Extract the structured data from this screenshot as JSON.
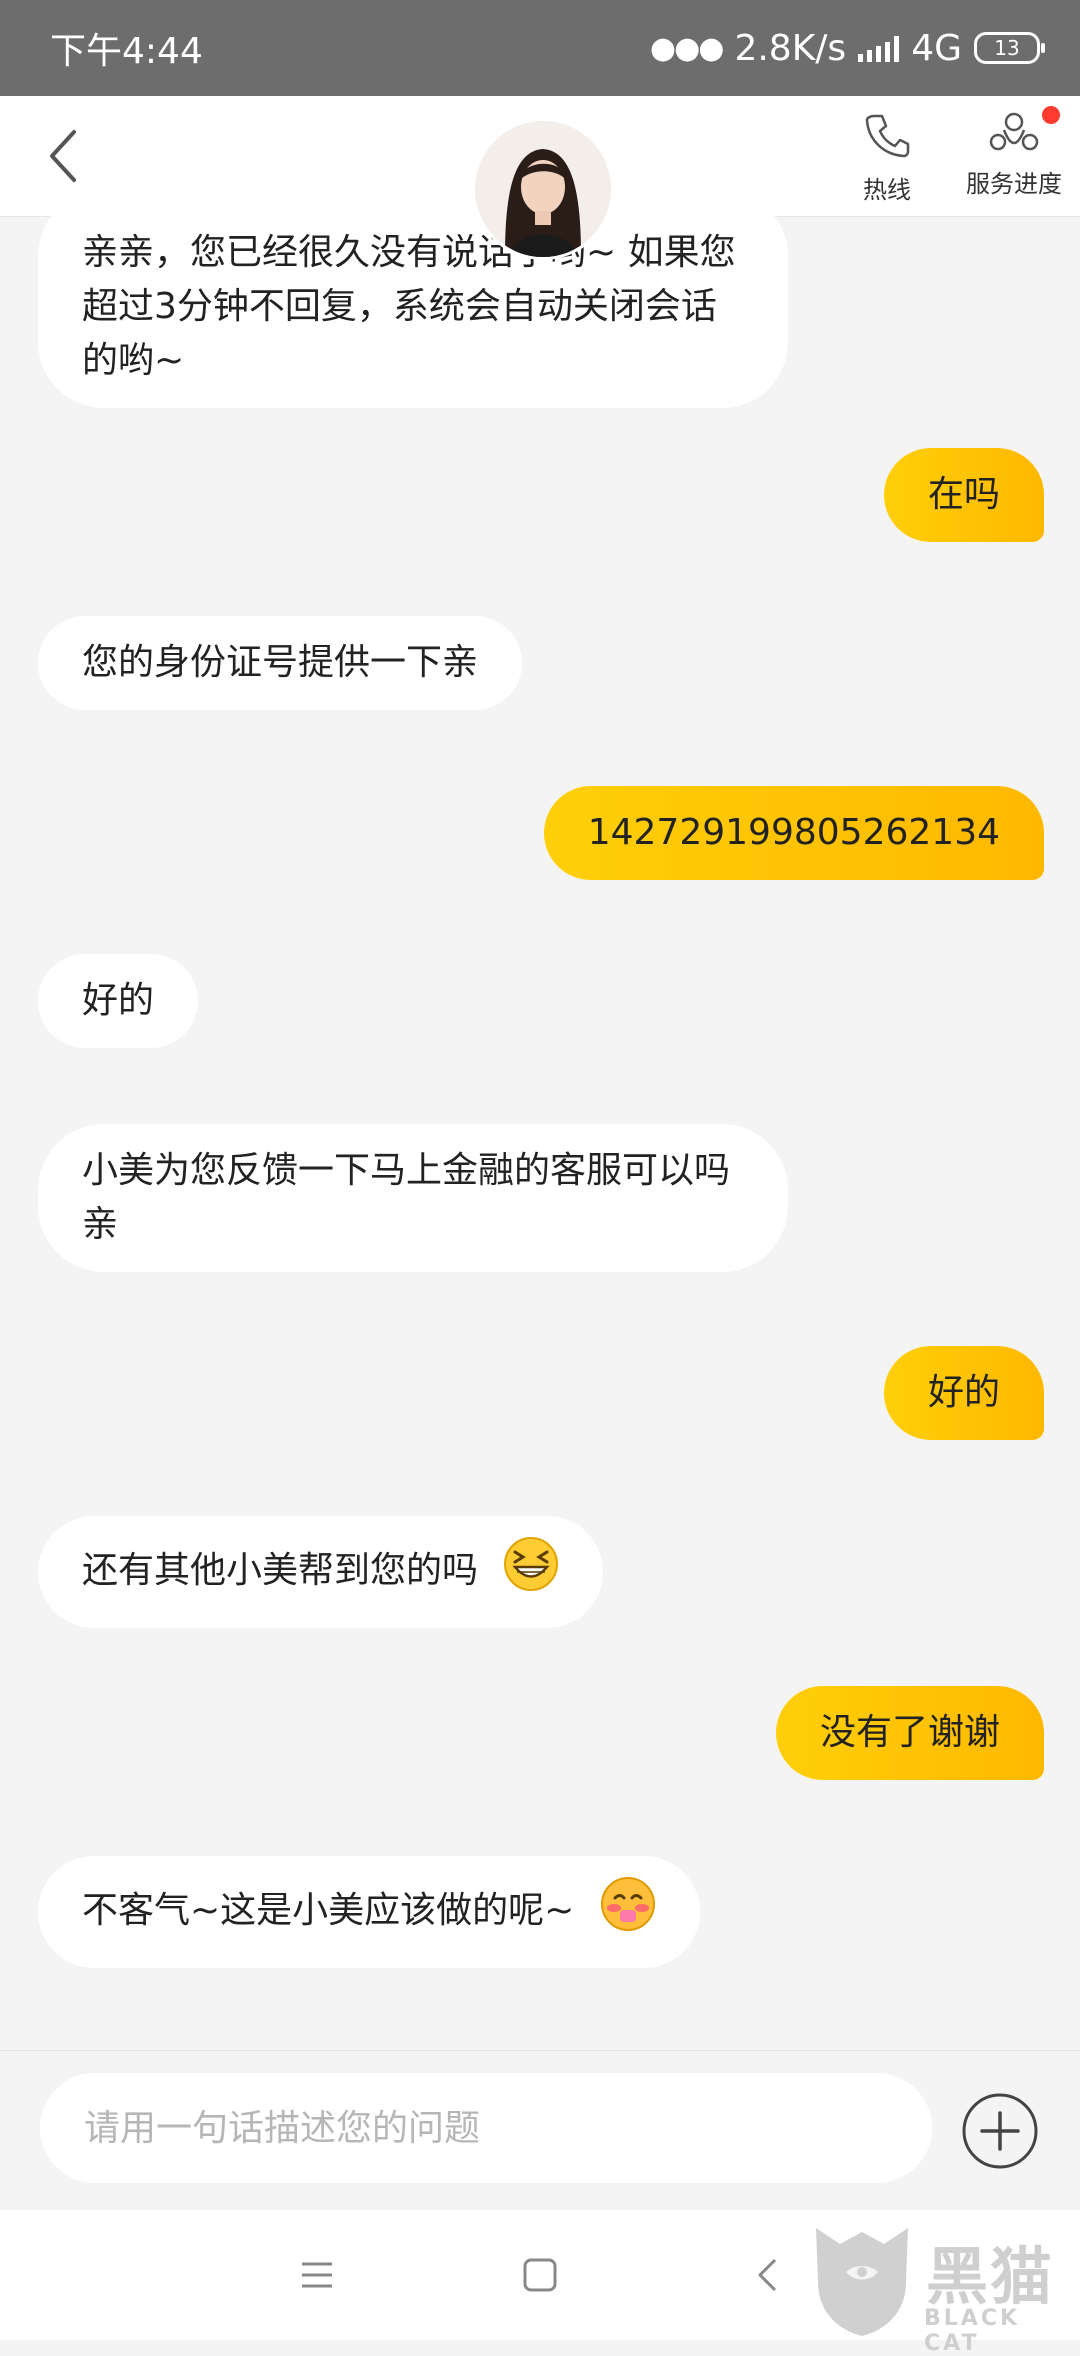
{
  "status_bar": {
    "time": "下午4:44",
    "speed": "2.8K/s",
    "network": "4G",
    "battery": "13"
  },
  "header": {
    "hotline_label": "热线",
    "progress_label": "服务进度",
    "has_notification": true
  },
  "messages": [
    {
      "side": "in",
      "text": "亲亲，您已经很久没有说话了哟~ 如果您超过3分钟不回复，系统会自动关闭会话的哟~"
    },
    {
      "side": "out",
      "text": "在吗"
    },
    {
      "side": "in",
      "text": "您的身份证号提供一下亲"
    },
    {
      "side": "out",
      "text": "142729199805262134"
    },
    {
      "side": "in",
      "text": "好的"
    },
    {
      "side": "in",
      "text": "小美为您反馈一下马上金融的客服可以吗亲"
    },
    {
      "side": "out",
      "text": "好的"
    },
    {
      "side": "in",
      "text": "还有其他小美帮到您的吗",
      "emoji": "grinning-squint-emoji"
    },
    {
      "side": "out",
      "text": "没有了谢谢"
    },
    {
      "side": "in",
      "text": "不客气~这是小美应该做的呢~",
      "emoji": "blushing-emoji"
    }
  ],
  "input": {
    "placeholder": "请用一句话描述您的问题",
    "value": ""
  },
  "watermark": {
    "brand": "黑猫",
    "brand_en": "BLACK CAT"
  },
  "colors": {
    "accent": "#ffc107",
    "status_bar": "#6d6d6d",
    "notification_dot": "#ff3b30",
    "background": "#f4f4f4"
  }
}
